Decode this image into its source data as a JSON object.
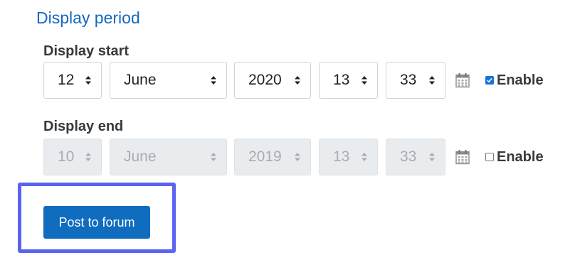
{
  "section_title": "Display period",
  "display_start": {
    "label": "Display start",
    "day": "12",
    "month": "June",
    "year": "2020",
    "hour": "13",
    "minute": "33",
    "enable_label": "Enable",
    "enabled": true
  },
  "display_end": {
    "label": "Display end",
    "day": "10",
    "month": "June",
    "year": "2019",
    "hour": "13",
    "minute": "33",
    "enable_label": "Enable",
    "enabled": false
  },
  "submit": {
    "label": "Post to forum"
  },
  "colors": {
    "accent": "#0f6cbf",
    "section_title": "#1469bf",
    "focus_frame": "#5a63f2",
    "checkbox_checked": "#1a73d6",
    "disabled_bg": "#e9ecef"
  },
  "icons": {
    "calendar": "calendar-icon",
    "select_arrows": "sort-arrows-icon",
    "check": "checkmark-icon"
  }
}
